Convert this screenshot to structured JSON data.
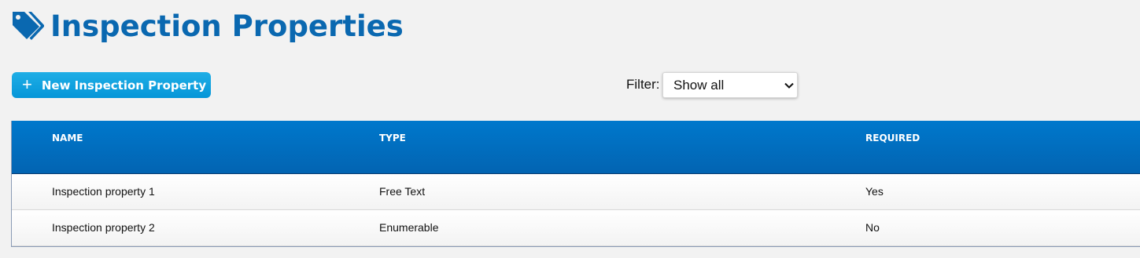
{
  "header": {
    "title": "Inspection Properties",
    "icon": "tag-icon",
    "title_color": "#0a68b0"
  },
  "toolbar": {
    "new_button_label": "New Inspection Property",
    "new_button_icon": "plus-icon",
    "filter_label": "Filter:",
    "filter_value": "Show all"
  },
  "table": {
    "columns": [
      "NAME",
      "TYPE",
      "REQUIRED"
    ],
    "rows": [
      [
        "Inspection property 1",
        "Free Text",
        "Yes"
      ],
      [
        "Inspection property 2",
        "Enumerable",
        "No"
      ]
    ]
  },
  "colors": {
    "header_bar": "#0078cc",
    "button": "#0596d8",
    "page_bg": "#f2f2f2"
  }
}
